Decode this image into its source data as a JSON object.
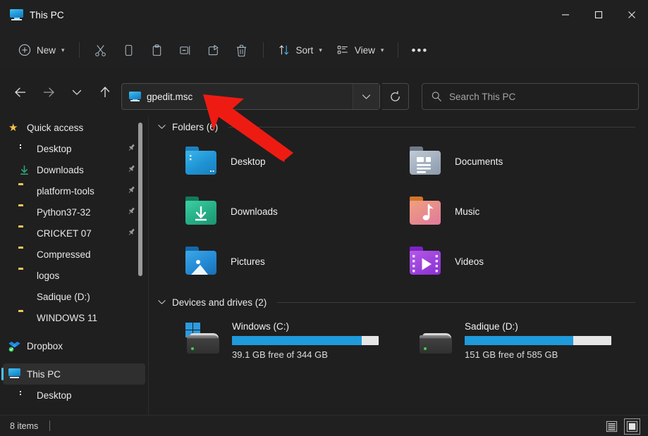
{
  "window": {
    "title": "This PC",
    "title_icon": "this-pc-monitor-icon",
    "minimize": "—",
    "maximize": "□",
    "close": "✕"
  },
  "toolbar": {
    "new_label": "New",
    "new_icon": "plus-circle-icon",
    "cut_icon": "scissors-icon",
    "copy_icon": "copy-icon",
    "paste_icon": "clipboard-paste-icon",
    "rename_icon": "rename-icon",
    "share_icon": "share-icon",
    "delete_icon": "trash-icon",
    "sort_label": "Sort",
    "sort_icon": "sort-arrows-icon",
    "view_label": "View",
    "view_icon": "view-list-icon",
    "more_label": "•••"
  },
  "address": {
    "back_icon": "back-arrow-icon",
    "forward_icon": "forward-arrow-icon",
    "recent_icon": "chevron-down-icon",
    "up_icon": "up-arrow-icon",
    "value": "gpedit.msc",
    "path_icon": "this-pc-monitor-icon",
    "dropdown_icon": "chevron-down-icon",
    "refresh_icon": "refresh-icon"
  },
  "search": {
    "placeholder": "Search This PC",
    "icon": "search-icon"
  },
  "sidebar": {
    "scrollbar": "vertical-scrollbar",
    "items": [
      {
        "label": "Quick access",
        "icon": "star-icon",
        "type": "root",
        "pinned": false,
        "selected": false
      },
      {
        "label": "Desktop",
        "icon": "desktop-icon",
        "type": "child",
        "pinned": true,
        "selected": false
      },
      {
        "label": "Downloads",
        "icon": "download-icon",
        "type": "child",
        "pinned": true,
        "selected": false
      },
      {
        "label": "platform-tools",
        "icon": "folder-icon",
        "type": "child",
        "pinned": true,
        "selected": false
      },
      {
        "label": "Python37-32",
        "icon": "folder-icon",
        "type": "child",
        "pinned": true,
        "selected": false
      },
      {
        "label": "CRICKET 07",
        "icon": "folder-icon",
        "type": "child",
        "pinned": true,
        "selected": false
      },
      {
        "label": "Compressed",
        "icon": "folder-icon",
        "type": "child",
        "pinned": false,
        "selected": false
      },
      {
        "label": "logos",
        "icon": "folder-icon",
        "type": "child",
        "pinned": false,
        "selected": false
      },
      {
        "label": "Sadique (D:)",
        "icon": "drive-icon",
        "type": "child",
        "pinned": false,
        "selected": false
      },
      {
        "label": "WINDOWS 11",
        "icon": "folder-icon",
        "type": "child",
        "pinned": false,
        "selected": false
      },
      {
        "label": "Dropbox",
        "icon": "dropbox-icon",
        "type": "root",
        "pinned": false,
        "selected": false,
        "gap_before": true
      },
      {
        "label": "This PC",
        "icon": "this-pc-icon",
        "type": "root",
        "pinned": false,
        "selected": true,
        "gap_before": true
      },
      {
        "label": "Desktop",
        "icon": "desktop-icon",
        "type": "child",
        "pinned": false,
        "selected": false
      }
    ]
  },
  "content": {
    "folders_group": {
      "title": "Folders (6)",
      "chevron": "⌄",
      "items": [
        {
          "label": "Desktop",
          "icon": "desktop-folder-icon"
        },
        {
          "label": "Documents",
          "icon": "documents-folder-icon"
        },
        {
          "label": "Downloads",
          "icon": "downloads-folder-icon"
        },
        {
          "label": "Music",
          "icon": "music-folder-icon"
        },
        {
          "label": "Pictures",
          "icon": "pictures-folder-icon"
        },
        {
          "label": "Videos",
          "icon": "videos-folder-icon"
        }
      ]
    },
    "drives_group": {
      "title": "Devices and drives (2)",
      "chevron": "⌄",
      "items": [
        {
          "name": "Windows (C:)",
          "icon": "hard-drive-windows-icon",
          "free_text": "39.1 GB free of 344 GB",
          "used_percent": 88.6,
          "free_gb": 39.1,
          "total_gb": 344
        },
        {
          "name": "Sadique (D:)",
          "icon": "hard-drive-icon",
          "free_text": "151 GB free of 585 GB",
          "used_percent": 74.2,
          "free_gb": 151,
          "total_gb": 585
        }
      ]
    }
  },
  "statusbar": {
    "item_count": "8 items",
    "details_view_icon": "details-view-icon",
    "large_icons_view_icon": "large-icons-view-icon",
    "active_view": "large-icons-view"
  },
  "annotation": {
    "type": "red-arrow",
    "color": "#ee1b13",
    "points_to": "address-bar"
  },
  "colors": {
    "accent": "#4cc2ff",
    "drive_bar": "#1f9ada",
    "window_bg": "#1f1f1f",
    "chrome_bg": "#202020",
    "annotation_red": "#ee1b13"
  }
}
